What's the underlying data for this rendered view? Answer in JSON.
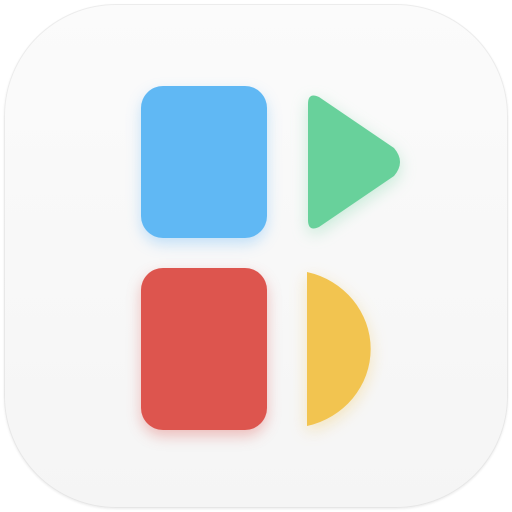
{
  "app_icon": {
    "background_color": "#f5f5f5",
    "shapes": [
      {
        "name": "blue-rounded-square",
        "color": "#60b8f4"
      },
      {
        "name": "green-play-triangle",
        "color": "#68d19b"
      },
      {
        "name": "red-rounded-square",
        "color": "#dd554e"
      },
      {
        "name": "yellow-half-circle",
        "color": "#f2c450"
      }
    ]
  }
}
